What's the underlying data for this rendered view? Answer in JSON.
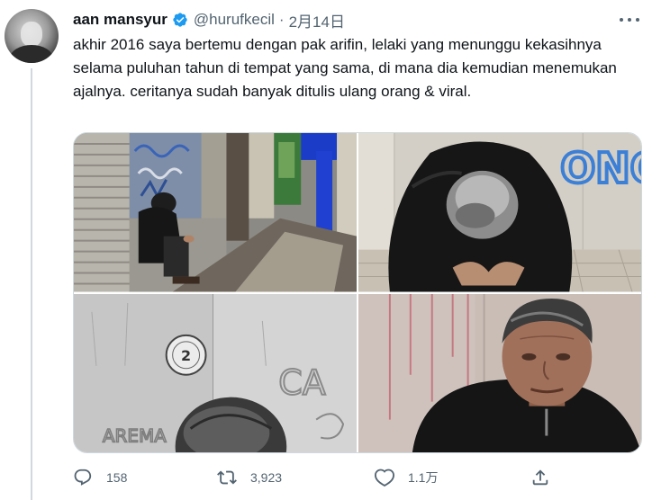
{
  "tweet": {
    "author_name": "aan mansyur",
    "handle": "@hurufkecil",
    "separator": "·",
    "date": "2月14日",
    "text": "akhir 2016 saya bertemu dengan pak arifin, lelaki yang menunggu kekasihnya selama puluhan tahun di tempat yang sama, di mana dia kemudian menemukan ajalnya. ceritanya sudah banyak ditulis ulang orang & viral."
  },
  "photos": {
    "photo2_graffiti": "ONO",
    "photo3_sticker_number": "2",
    "photo3_graffiti_1": "AREMA",
    "photo3_graffiti_2": "CA"
  },
  "metrics": {
    "replies": "158",
    "retweets": "3,923",
    "likes": "1.1万"
  },
  "icons": {
    "verified": "verified-badge-icon",
    "more": "more-dots-icon",
    "reply": "reply-icon",
    "retweet": "retweet-icon",
    "like": "heart-icon",
    "share": "share-icon"
  },
  "colors": {
    "text": "#0f1419",
    "secondary": "#536471",
    "verified": "#1d9bf0",
    "border": "#cfd9de"
  }
}
